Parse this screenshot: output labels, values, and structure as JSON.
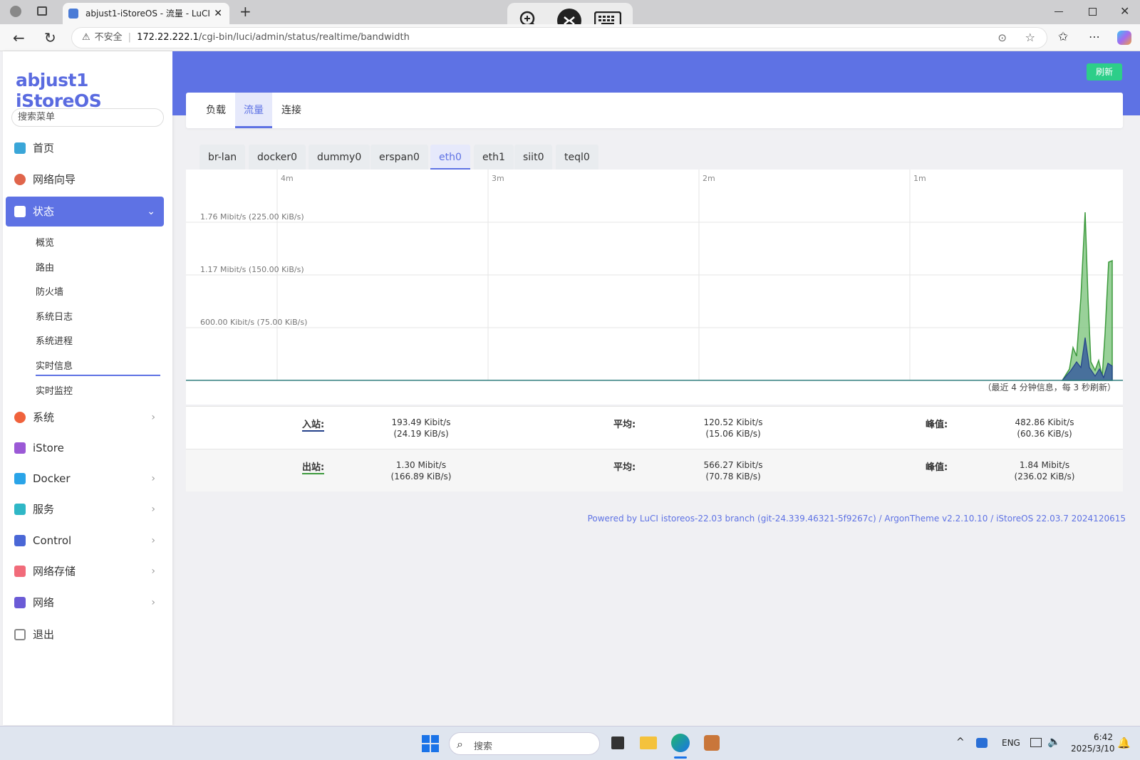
{
  "browser": {
    "tab_title": "abjust1-iStoreOS - 流量 - LuCI",
    "close": "✕",
    "new_tab": "+",
    "security": "不安全",
    "url_host": "172.22.222.1",
    "url_path": "/cgi-bin/luci/admin/status/realtime/bandwidth"
  },
  "sidebar": {
    "logo": "abjust1 iStoreOS",
    "search_placeholder": "搜索菜单",
    "items": [
      {
        "label": "首页",
        "icon": "home-icon",
        "color": "#3aa6d8"
      },
      {
        "label": "网络向导",
        "icon": "wizard-icon",
        "color": "#e0654b"
      },
      {
        "label": "状态",
        "icon": "status-icon",
        "color": "#ffffff"
      },
      {
        "label": "系统",
        "icon": "system-icon",
        "color": "#f0623c"
      },
      {
        "label": "iStore",
        "icon": "istore-icon",
        "color": "#9b59d6"
      },
      {
        "label": "Docker",
        "icon": "docker-icon",
        "color": "#2aa4e8"
      },
      {
        "label": "服务",
        "icon": "service-icon",
        "color": "#2fb7c6"
      },
      {
        "label": "Control",
        "icon": "control-icon",
        "color": "#4a67d6"
      },
      {
        "label": "网络存储",
        "icon": "storage-icon",
        "color": "#f16b7a"
      },
      {
        "label": "网络",
        "icon": "network-icon",
        "color": "#6b5bd6"
      },
      {
        "label": "退出",
        "icon": "logout-icon",
        "color": "#888888"
      }
    ],
    "subitems": [
      "概览",
      "路由",
      "防火墙",
      "系统日志",
      "系统进程",
      "实时信息",
      "实时监控"
    ]
  },
  "header": {
    "refresh": "刷新"
  },
  "main_tabs": [
    "负载",
    "流量",
    "连接"
  ],
  "iface_tabs": [
    "br-lan",
    "docker0",
    "dummy0",
    "erspan0",
    "eth0",
    "eth1",
    "siit0",
    "teql0"
  ],
  "graph": {
    "time_labels": [
      "4m",
      "3m",
      "2m",
      "1m"
    ],
    "y_labels": [
      "1.76 Mibit/s (225.00 KiB/s)",
      "1.17 Mibit/s (150.00 KiB/s)",
      "600.00 Kibit/s (75.00 KiB/s)"
    ],
    "note": "（最近 4 分钟信息，每 3 秒刷新）"
  },
  "stats": {
    "in": {
      "label": "入站:",
      "cur1": "193.49 Kibit/s",
      "cur2": "(24.19 KiB/s)",
      "avg_label": "平均:",
      "avg1": "120.52 Kibit/s",
      "avg2": "(15.06 KiB/s)",
      "peak_label": "峰值:",
      "peak1": "482.86 Kibit/s",
      "peak2": "(60.36 KiB/s)"
    },
    "out": {
      "label": "出站:",
      "cur1": "1.30 Mibit/s",
      "cur2": "(166.89 KiB/s)",
      "avg_label": "平均:",
      "avg1": "566.27 Kibit/s",
      "avg2": "(70.78 KiB/s)",
      "peak_label": "峰值:",
      "peak1": "1.84 Mibit/s",
      "peak2": "(236.02 KiB/s)"
    }
  },
  "footer": "Powered by LuCI istoreos-22.03 branch (git-24.339.46321-5f9267c) / ArgonTheme v2.2.10.10 / iStoreOS 22.03.7 2024120615",
  "taskbar": {
    "search": "搜索",
    "lang": "ENG",
    "time": "6:42",
    "date": "2025/3/10"
  }
}
